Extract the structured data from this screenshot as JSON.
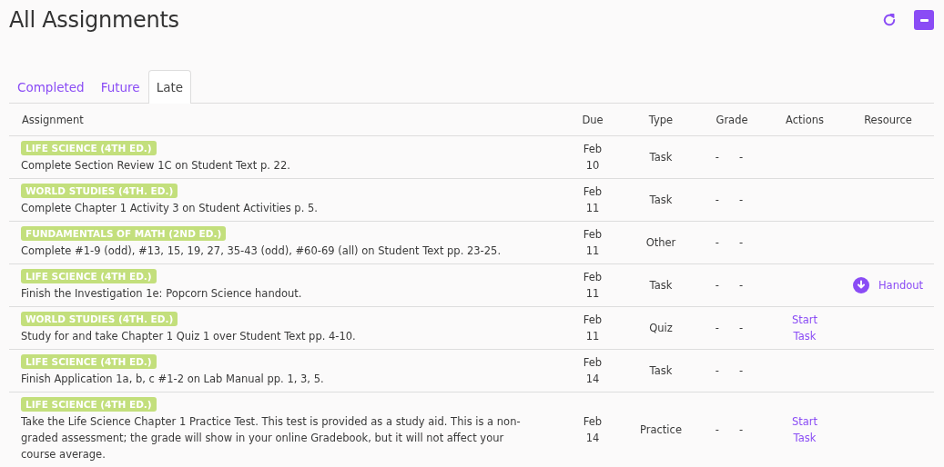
{
  "title": "All Assignments",
  "tabs": [
    {
      "label": "Completed",
      "selected": false
    },
    {
      "label": "Future",
      "selected": false
    },
    {
      "label": "Late",
      "selected": true
    }
  ],
  "table": {
    "columns": [
      "Assignment",
      "Due",
      "Type",
      "Grade",
      "Actions",
      "Resource"
    ],
    "rows": [
      {
        "course": "LIFE SCIENCE (4TH ED.)",
        "description": "Complete Section Review 1C on Student Text p. 22.",
        "due": "Feb 10",
        "type": "Task",
        "grade": [
          "-",
          "-"
        ]
      },
      {
        "course": "WORLD STUDIES (4TH. ED.)",
        "description": "Complete Chapter 1 Activity 3 on Student Activities p. 5.",
        "due": "Feb 11",
        "type": "Task",
        "grade": [
          "-",
          "-"
        ]
      },
      {
        "course": "FUNDAMENTALS OF MATH (2ND ED.)",
        "description": "Complete #1-9 (odd), #13, 15, 19, 27, 35-43 (odd), #60-69 (all) on Student Text pp. 23-25.",
        "due": "Feb 11",
        "type": "Other",
        "grade": [
          "-",
          "-"
        ]
      },
      {
        "course": "LIFE SCIENCE (4TH ED.)",
        "description": "Finish the Investigation 1e: Popcorn Science handout.",
        "due": "Feb 11",
        "type": "Task",
        "grade": [
          "-",
          "-"
        ],
        "resource": "Handout"
      },
      {
        "course": "WORLD STUDIES (4TH. ED.)",
        "description": "Study for and take Chapter 1 Quiz 1 over Student Text pp. 4-10.",
        "due": "Feb 11",
        "type": "Quiz",
        "grade": [
          "-",
          "-"
        ],
        "action": "Start Task"
      },
      {
        "course": "LIFE SCIENCE (4TH ED.)",
        "description": "Finish Application 1a, b, c #1-2 on Lab Manual pp. 1, 3, 5.",
        "due": "Feb 14",
        "type": "Task",
        "grade": [
          "-",
          "-"
        ]
      },
      {
        "course": "LIFE SCIENCE (4TH ED.)",
        "description": "Take the Life Science Chapter 1 Practice Test. This test is provided as a study aid. This is a non-graded assessment; the grade will show in your online Gradebook, but it will not affect your course average.",
        "due": "Feb 14",
        "type": "Practice",
        "grade": [
          "-",
          "-"
        ],
        "action": "Start Task"
      }
    ]
  }
}
